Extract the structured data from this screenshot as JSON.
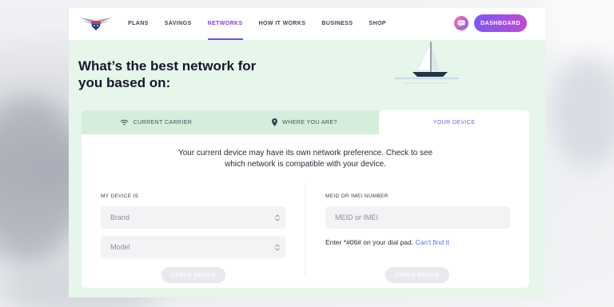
{
  "nav": {
    "items": [
      {
        "label": "PLANS",
        "active": false
      },
      {
        "label": "SAVINGS",
        "active": false
      },
      {
        "label": "NETWORKS",
        "active": true
      },
      {
        "label": "HOW IT WORKS",
        "active": false
      },
      {
        "label": "BUSINESS",
        "active": false
      },
      {
        "label": "SHOP",
        "active": false
      }
    ],
    "dashboard_label": "DASHBOARD",
    "chat_icon": "chat-bubble-icon"
  },
  "hero": {
    "headline_line1": "What’s the best network for",
    "headline_line2": "you based on:",
    "illustration": "sailboat"
  },
  "tabs": [
    {
      "label": "CURRENT CARRIER",
      "icon": "wifi-icon",
      "active": false
    },
    {
      "label": "WHERE YOU ARE?",
      "icon": "location-pin-icon",
      "active": false
    },
    {
      "label": "YOUR DEVICE",
      "icon": "",
      "active": true
    }
  ],
  "device_panel": {
    "intro_line1": "Your current device may have its own network preference. Check to see",
    "intro_line2": "which network is compatible with your device.",
    "device_label": "MY DEVICE IS",
    "brand_placeholder": "Brand",
    "model_placeholder": "Model",
    "imei_label": "MEID OR IMEI NUMBER",
    "imei_placeholder": "MEID or IMEI",
    "hint_text": "Enter *#06# on your dial pad.",
    "hint_link": "Can't find it",
    "check_button_left": "CHECK DEVICE",
    "check_button_right": "CHECK DEVICE"
  },
  "colors": {
    "accent": "#7b44e8",
    "page_bg": "#e6f6ea",
    "active_tab_text": "#6b63f0",
    "link": "#5a6ff0"
  }
}
